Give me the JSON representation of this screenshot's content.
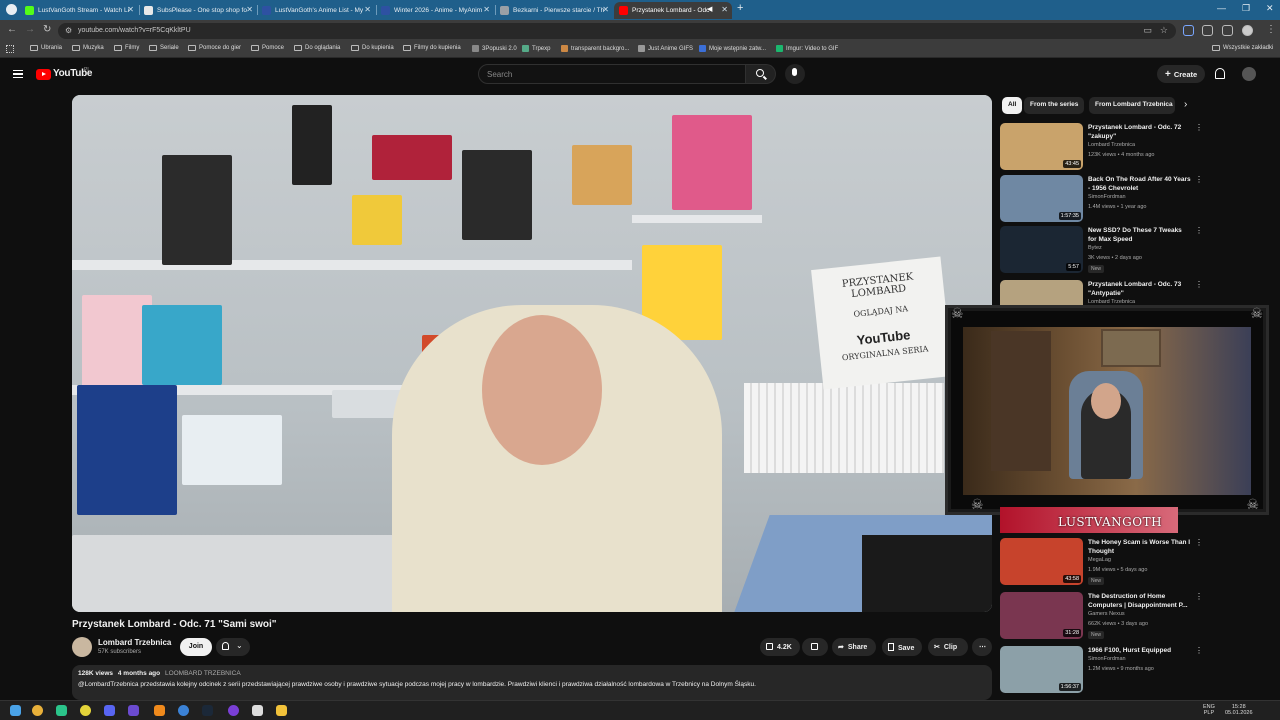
{
  "browser": {
    "tabs": [
      {
        "title": "LustVanGoth Stream - Watch Li",
        "color": "#53fc18"
      },
      {
        "title": "SubsPlease - One stop shop fo",
        "color": "#e8e8e8"
      },
      {
        "title": "LustVanGoth's Anime List - My",
        "color": "#2e51a2"
      },
      {
        "title": "Winter 2026 - Anime - MyAnim",
        "color": "#2e51a2"
      },
      {
        "title": "Bezkarni - Pierwsze starcie / Th",
        "color": "#9aa0a6"
      },
      {
        "title": "Przystanek Lombard - Odc",
        "color": "#ff0000"
      }
    ],
    "new_tab": "+",
    "url": "youtube.com/watch?v=rF5CqKkltPU",
    "bookmarks": [
      "Ubrania",
      "Muzyka",
      "Filmy",
      "Seriale",
      "Pomoce do gier",
      "Pomoce",
      "Do oglądania",
      "Do kupienia",
      "Filmy do kupienia",
      "3Popuski 2.0",
      "Trpexp",
      "transparent backgro...",
      "Just Anime GIFS",
      "Moje wstępnie zatw...",
      "Imgur: Video to GIF"
    ],
    "all_bookmarks": "Wszystkie zakładki"
  },
  "youtube": {
    "logo": "YouTube",
    "country": "PL",
    "search_placeholder": "Search",
    "create_label": "Create"
  },
  "video": {
    "title": "Przystanek Lombard - Odc. 71 \"Sami swoi\"",
    "sign_line1": "PRZYSTANEK",
    "sign_line2": "LOMBARD",
    "sign_line3": "OGLĄDAJ NA",
    "sign_line4": "YouTube",
    "sign_line5": "ORYGINALNA SERIA",
    "channel": "Lombard Trzebnica",
    "subscribers": "57K subscribers",
    "join_label": "Join",
    "likes": "4.2K",
    "share_label": "Share",
    "save_label": "Save",
    "clip_label": "Clip",
    "views": "128K views",
    "age": "4 months ago",
    "tag": "LOOMBARD TRZEBNICA",
    "description": "@LombardTrzebnica przedstawia kolejny odcinek z serii przedstawiającej prawdziwe osoby i prawdziwe sytuacje podczas mojej pracy w lombardzie. Prawdziwi klienci i prawdziwa działalność lombardowa w Trzebnicy na Dolnym Śląsku."
  },
  "sidebar": {
    "chips": [
      "All",
      "From the series",
      "From Lombard Trzebnica"
    ],
    "recommendations": [
      {
        "title": "Przystanek Lombard - Odc. 72 \"zakupy\"",
        "channel": "Lombard Trzebnica",
        "meta": "123K views • 4 months ago",
        "duration": "43:45",
        "badge": "",
        "thumb": "#c9a36b"
      },
      {
        "title": "Back On The Road After 40 Years - 1956 Chevrolet",
        "channel": "SimonFordman",
        "meta": "1.4M views • 1 year ago",
        "duration": "1:57:35",
        "badge": "",
        "thumb": "#6f88a3"
      },
      {
        "title": "New SSD? Do These 7 Tweaks for Max Speed",
        "channel": "Bytez",
        "meta": "3K views • 2 days ago",
        "duration": "5:57",
        "badge": "New",
        "thumb": "#1b2633"
      },
      {
        "title": "Przystanek Lombard - Odc. 73 \"Antypatie\"",
        "channel": "Lombard Trzebnica",
        "meta": "115K views • 4 months ago",
        "duration": "",
        "badge": "",
        "thumb": "#b5a27f"
      },
      {
        "title": "The Honey Scam is Worse Than I Thought",
        "channel": "MegaLag",
        "meta": "1.9M views • 5 days ago",
        "duration": "43:58",
        "badge": "New",
        "thumb": "#c7432c"
      },
      {
        "title": "The Destruction of Home Computers | Disappointment P...",
        "channel": "Gamers Nexus",
        "meta": "662K views • 3 days ago",
        "duration": "31:28",
        "badge": "New",
        "thumb": "#7a3650"
      },
      {
        "title": "1966 F100, Hurst Equipped",
        "channel": "SimonFordman",
        "meta": "1.2M views • 9 months ago",
        "duration": "1:56:37",
        "badge": "",
        "thumb": "#8ca0a8"
      }
    ]
  },
  "overlay": {
    "banner_text": "LUSTVANGOTH"
  },
  "taskbar": {
    "lang": "ENG",
    "layout": "PLP",
    "time": "15:28",
    "date": "05.01.2026"
  }
}
